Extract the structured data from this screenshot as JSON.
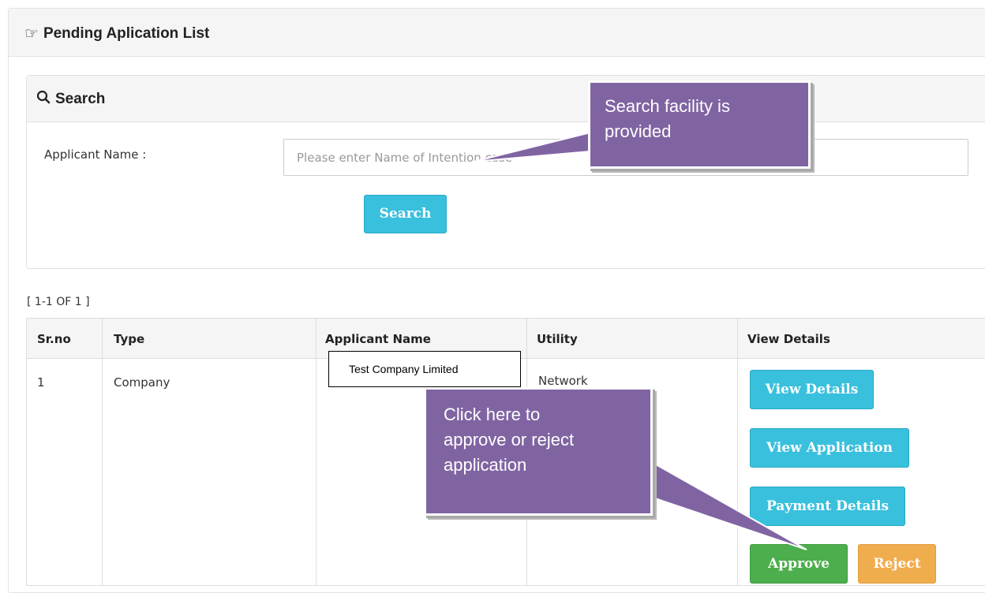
{
  "panel": {
    "title": "Pending Aplication List",
    "title_icon": "hand-point-right-icon"
  },
  "search": {
    "title": "Search",
    "title_icon": "search-icon",
    "applicant_label": "Applicant Name :",
    "placeholder": "Please enter Name of Intention case",
    "button_label": "Search"
  },
  "results": {
    "count_text": "[ 1-1 OF 1 ]",
    "columns": [
      "Sr.no",
      "Type",
      "Applicant Name",
      "Utility",
      "View Details"
    ],
    "rows": [
      {
        "sr_no": "1",
        "type": "Company",
        "applicant_name": "Test Company  Limited",
        "utility": "Network",
        "actions": {
          "view_details": "View Details",
          "view_application": "View Application",
          "payment_details": "Payment Details",
          "approve": "Approve",
          "reject": "Reject"
        }
      }
    ]
  },
  "annotations": {
    "search_note_line1": "Search facility is",
    "search_note_line2": "provided",
    "approve_note_line1": "Click here to",
    "approve_note_line2": "approve or reject",
    "approve_note_line3": "application"
  },
  "colors": {
    "info": "#39c0dd",
    "success": "#4cae4c",
    "warning": "#f0ad4e",
    "callout": "#8064a2"
  }
}
